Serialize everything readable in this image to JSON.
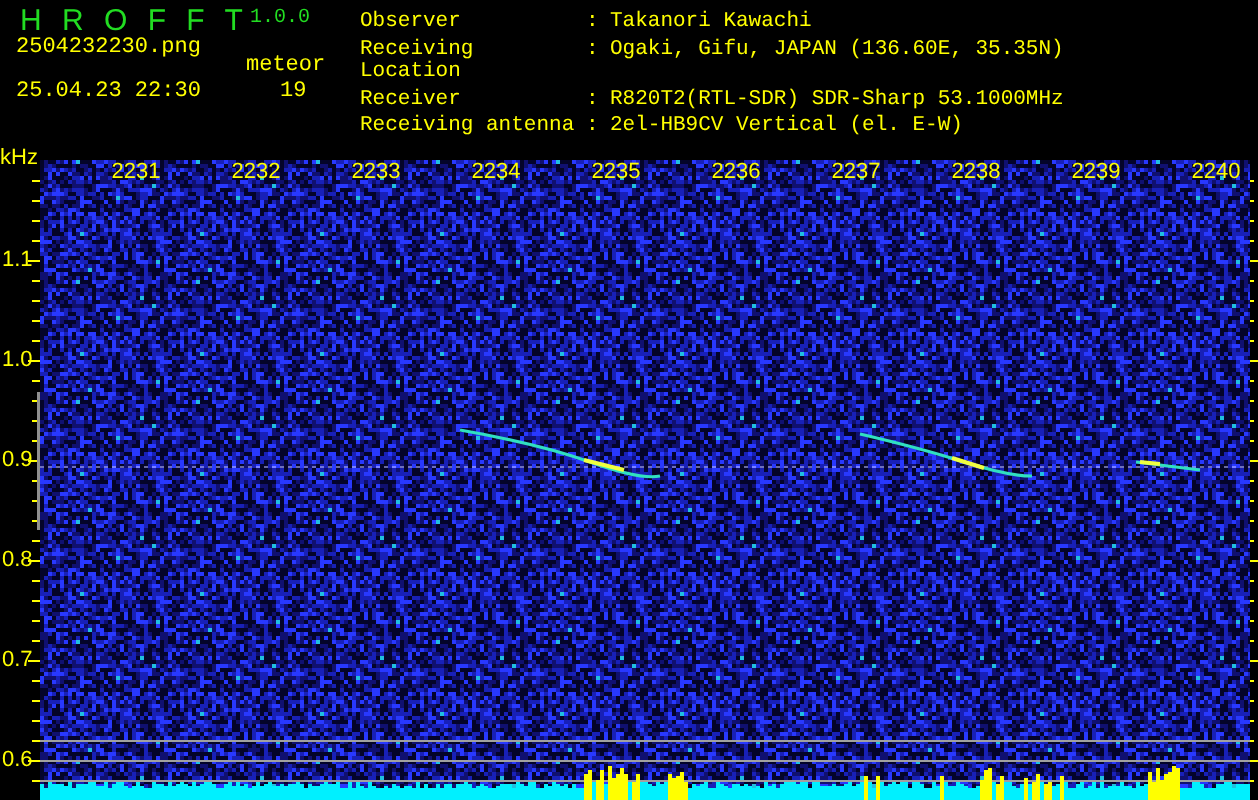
{
  "app": {
    "name": "H R O F F T",
    "version": "1.0.0"
  },
  "file": {
    "filename": "2504232230.png",
    "datetime": "25.04.23 22:30"
  },
  "detection": {
    "label": "meteor",
    "count": "19"
  },
  "station": [
    {
      "label": "Observer",
      "separator": ":",
      "value": "Takanori Kawachi"
    },
    {
      "label": "Receiving Location",
      "separator": ":",
      "value": "Ogaki, Gifu, JAPAN (136.60E, 35.35N)"
    },
    {
      "label": "Receiver",
      "separator": ":",
      "value": "R820T2(RTL-SDR) SDR-Sharp 53.1000MHz"
    },
    {
      "label": "Receiving antenna",
      "separator": ":",
      "value": "2el-HB9CV Vertical (el. E-W)"
    }
  ],
  "frequency_axis": {
    "unit": "kHz",
    "ticks": [
      "1.1",
      "1.0",
      "0.9",
      "0.8",
      "0.7",
      "0.6"
    ]
  },
  "time_axis": {
    "ticks": [
      "2231",
      "2232",
      "2233",
      "2234",
      "2235",
      "2236",
      "2237",
      "2238",
      "2239",
      "2240"
    ]
  }
}
